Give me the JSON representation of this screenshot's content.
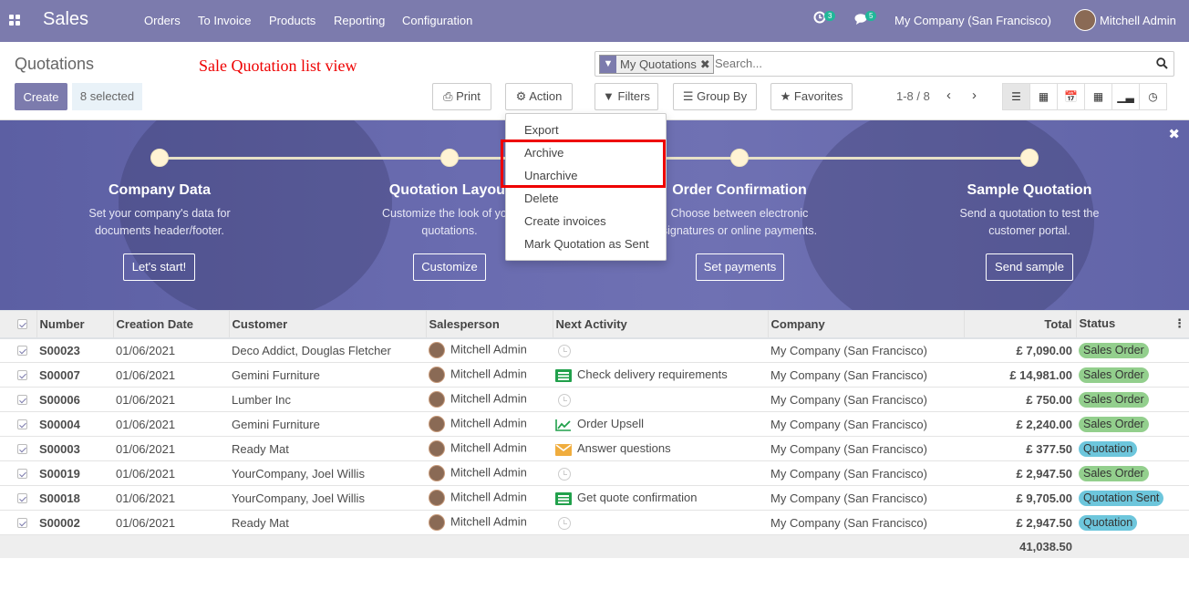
{
  "topbar": {
    "brand": "Sales",
    "menu": [
      "Orders",
      "To Invoice",
      "Products",
      "Reporting",
      "Configuration"
    ],
    "activity_count": "3",
    "message_count": "5",
    "company": "My Company (San Francisco)",
    "user": "Mitchell Admin",
    "color": "#7c7bad"
  },
  "control_panel": {
    "title": "Quotations",
    "annotation": "Sale Quotation list view",
    "create_label": "Create",
    "selected_label": "8 selected",
    "print_label": "Print",
    "action_label": "Action",
    "filters_label": "Filters",
    "group_by_label": "Group By",
    "favorites_label": "Favorites",
    "search": {
      "facet": "My Quotations",
      "placeholder": "Search..."
    },
    "pager": "1-8 / 8",
    "views": [
      "list-icon",
      "kanban-icon",
      "calendar-icon",
      "pivot-icon",
      "graph-icon",
      "activity-icon"
    ]
  },
  "action_menu": {
    "items": [
      "Export",
      "Archive",
      "Unarchive",
      "Delete",
      "Create invoices",
      "Mark Quotation as Sent"
    ]
  },
  "banner": {
    "steps": [
      {
        "title": "Company Data",
        "desc1": "Set your company's data for",
        "desc2": "documents header/footer.",
        "button": "Let's start!"
      },
      {
        "title": "Quotation Layout",
        "desc1": "Customize the look of your",
        "desc2": "quotations.",
        "button": "Customize"
      },
      {
        "title": "Order Confirmation",
        "desc1": "Choose between electronic",
        "desc2": "signatures or online payments.",
        "button": "Set payments"
      },
      {
        "title": "Sample Quotation",
        "desc1": "Send a quotation to test the",
        "desc2": "customer portal.",
        "button": "Send sample"
      }
    ]
  },
  "table": {
    "headers": [
      "Number",
      "Creation Date",
      "Customer",
      "Salesperson",
      "Next Activity",
      "Company",
      "Total",
      "Status"
    ],
    "rows": [
      {
        "number": "S00023",
        "date": "01/06/2021",
        "customer": "Deco Addict, Douglas Fletcher",
        "salesperson": "Mitchell Admin",
        "activity": "",
        "activity_icon": "clock-icon",
        "company": "My Company (San Francisco)",
        "total": "£ 7,090.00",
        "status": "Sales Order"
      },
      {
        "number": "S00007",
        "date": "01/06/2021",
        "customer": "Gemini Furniture",
        "salesperson": "Mitchell Admin",
        "activity": "Check delivery requirements",
        "activity_icon": "todo-list-icon",
        "company": "My Company (San Francisco)",
        "total": "£ 14,981.00",
        "status": "Sales Order"
      },
      {
        "number": "S00006",
        "date": "01/06/2021",
        "customer": "Lumber Inc",
        "salesperson": "Mitchell Admin",
        "activity": "",
        "activity_icon": "clock-icon",
        "company": "My Company (San Francisco)",
        "total": "£ 750.00",
        "status": "Sales Order"
      },
      {
        "number": "S00004",
        "date": "01/06/2021",
        "customer": "Gemini Furniture",
        "salesperson": "Mitchell Admin",
        "activity": "Order Upsell",
        "activity_icon": "upsell-chart-icon",
        "company": "My Company (San Francisco)",
        "total": "£ 2,240.00",
        "status": "Sales Order"
      },
      {
        "number": "S00003",
        "date": "01/06/2021",
        "customer": "Ready Mat",
        "salesperson": "Mitchell Admin",
        "activity": "Answer questions",
        "activity_icon": "envelope-icon",
        "company": "My Company (San Francisco)",
        "total": "£ 377.50",
        "status": "Quotation"
      },
      {
        "number": "S00019",
        "date": "01/06/2021",
        "customer": "YourCompany, Joel Willis",
        "salesperson": "Mitchell Admin",
        "activity": "",
        "activity_icon": "clock-icon",
        "company": "My Company (San Francisco)",
        "total": "£ 2,947.50",
        "status": "Sales Order"
      },
      {
        "number": "S00018",
        "date": "01/06/2021",
        "customer": "YourCompany, Joel Willis",
        "salesperson": "Mitchell Admin",
        "activity": "Get quote confirmation",
        "activity_icon": "todo-list-icon",
        "company": "My Company (San Francisco)",
        "total": "£ 9,705.00",
        "status": "Quotation Sent"
      },
      {
        "number": "S00002",
        "date": "01/06/2021",
        "customer": "Ready Mat",
        "salesperson": "Mitchell Admin",
        "activity": "",
        "activity_icon": "clock-icon",
        "company": "My Company (San Francisco)",
        "total": "£ 2,947.50",
        "status": "Quotation"
      }
    ],
    "footer_total": "41,038.50"
  }
}
